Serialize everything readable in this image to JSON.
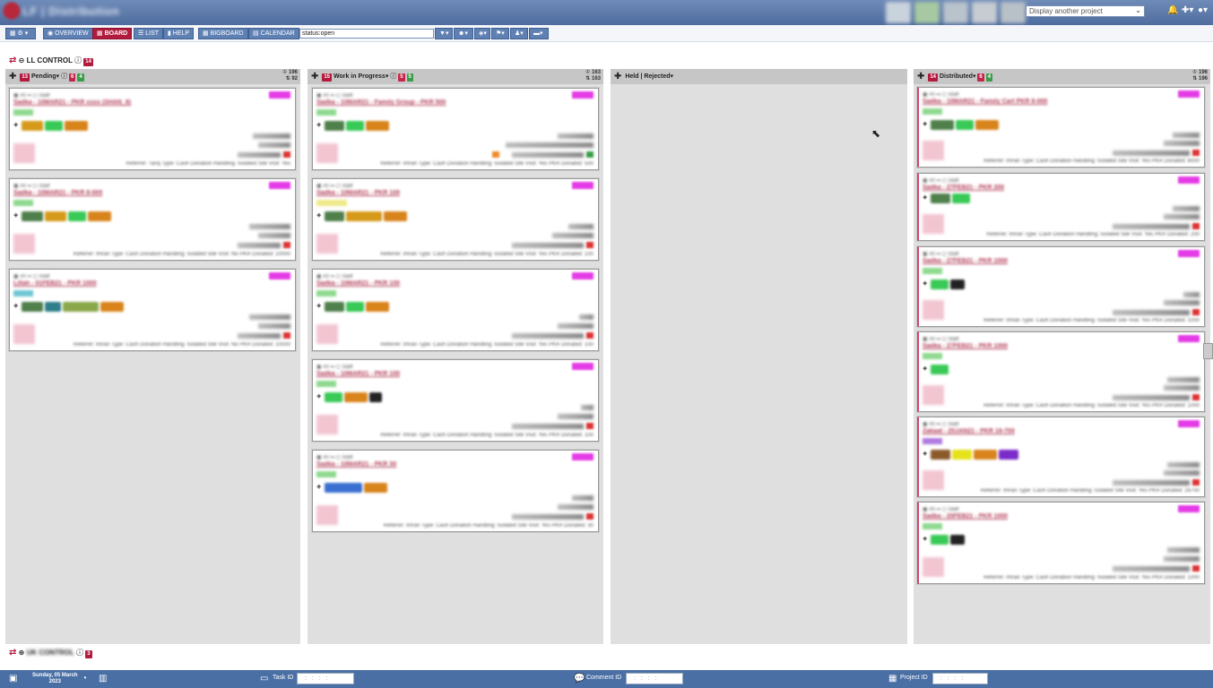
{
  "header": {
    "app_title": "LF | Distribution",
    "project_select_placeholder": "Display another project",
    "icons": [
      "bell-icon",
      "plus-icon",
      "user-menu-icon"
    ]
  },
  "toolbar": {
    "view_menu_label": "▾",
    "overview": "OVERVIEW",
    "board": "BOARD",
    "list": "LIST",
    "help": "HELP",
    "bigboard": "BIGBOARD",
    "calendar": "CALENDAR",
    "search_value": "status:open",
    "filter_buttons": [
      "▾",
      "▾",
      "▾",
      "▾",
      "▾",
      "▾"
    ]
  },
  "groups": [
    {
      "name": "LL CONTROL",
      "count": "14"
    },
    {
      "name": "UK CONTROL",
      "count": "3"
    }
  ],
  "columns": [
    {
      "title": "Pending",
      "count": "13",
      "red_badge": "6",
      "green_badge": "4",
      "stat_top": "196",
      "stat_bottom": "92"
    },
    {
      "title": "Work in Progress",
      "count": "15",
      "red_badge": "5",
      "green_badge": "5",
      "stat_top": "163",
      "stat_bottom": "163"
    },
    {
      "title": "Held | Rejected",
      "count": "",
      "red_badge": "",
      "green_badge": "",
      "stat_top": "",
      "stat_bottom": ""
    },
    {
      "title": "Distributed",
      "count": "14",
      "red_badge": "6",
      "green_badge": "4",
      "stat_top": "196",
      "stat_bottom": "196"
    }
  ],
  "cards": {
    "pending": [
      {
        "title": "Sadka - 10MAR21 - PKR xxxx (SHAN_8)",
        "footer": "Referrer: Tariq  Type: Cash  Donation Handling: Isolated  Site Visit: Yes"
      },
      {
        "title": "Sadka - 10MAR21 - PKR 8-000",
        "footer": "Referrer: Imran  Type: Cash  Donation Handling: Isolated  Site Visit: No  PKR Donated: 10000"
      },
      {
        "title": "Lillah - 01FEB21 - PKR 1000",
        "footer": "Referrer: Imran  Type: Cash  Donation Handling: Isolated  Site Visit: No  PKR Donated: 10000"
      }
    ],
    "wip": [
      {
        "title": "Sadka - 10MAR21 - Family Group - PKR 500",
        "footer": "Referrer: Imran  Type: Cash  Donation Handling: Isolated  Site Visit: Yes  PKR Donated: 500"
      },
      {
        "title": "Sadka - 10MAR21 - PKR 100",
        "footer": "Referrer: Imran  Type: Cash  Donation Handling: Isolated  Site Visit: Yes  PKR Donated: 100"
      },
      {
        "title": "Sadka - 10MAR21 - PKR 100",
        "footer": "Referrer: Imran  Type: Cash  Donation Handling: Isolated  Site Visit: Yes  PKR Donated: 100"
      },
      {
        "title": "Sadka - 10MAR21 - PKR 100",
        "footer": "Referrer: Imran  Type: Cash  Donation Handling: Isolated  Site Visit: Yes  PKR Donated: 100"
      },
      {
        "title": "Sadka - 10MAR21 - PKR 30",
        "footer": "Referrer: Imran  Type: Cash  Donation Handling: Isolated  Site Visit: Yes  PKR Donated: 30"
      }
    ],
    "distributed": [
      {
        "title": "Sadka - 10MAR21 - Family Cart PKR 8-000",
        "footer": "Referrer: Imran  Type: Cash  Donation Handling: Isolated  Site Visit: Yes  PKR Donated: 8000"
      },
      {
        "title": "Sadka - 27FEB21 - PKR 200",
        "footer": "Referrer: Imran  Type: Cash  Donation Handling: Isolated  Site Visit: Yes  PKR Donated: 200"
      },
      {
        "title": "Sadka - 27FEB21 - PKR 1000",
        "footer": "Referrer: Imran  Type: Cash  Donation Handling: Isolated  Site Visit: Yes  PKR Donated: 1000"
      },
      {
        "title": "Sadka - 27FEB21 - PKR 1000",
        "footer": "Referrer: Imran  Type: Cash  Donation Handling: Isolated  Site Visit: Yes  PKR Donated: 1000"
      },
      {
        "title": "Zakaat - 25JAN21 - PKR 16-700",
        "footer": "Referrer: Imran  Type: Cash  Donation Handling: Isolated  Site Visit: Yes  PKR Donated: 16700"
      },
      {
        "title": "Sadka - 20FEB21 - PKR 1000",
        "footer": "Referrer: Imran  Type: Cash  Donation Handling: Isolated  Site Visit: Yes  PKR Donated: 1000"
      }
    ]
  },
  "statusbar": {
    "date_line1": "Sunday, 05 March",
    "date_line2": "2023",
    "task_id_label": "Task ID",
    "comment_id_label": "Comment ID",
    "project_id_label": "Project ID",
    "box_placeholder": ": : : :"
  },
  "colors": {
    "accent": "#b31b3e",
    "header_blue": "#4e6c9e",
    "toolbar_button": "#5f80b3",
    "column_bg": "#dfdfdf",
    "green_badge": "#3a9c48",
    "tag_pink": "#e43be6"
  }
}
